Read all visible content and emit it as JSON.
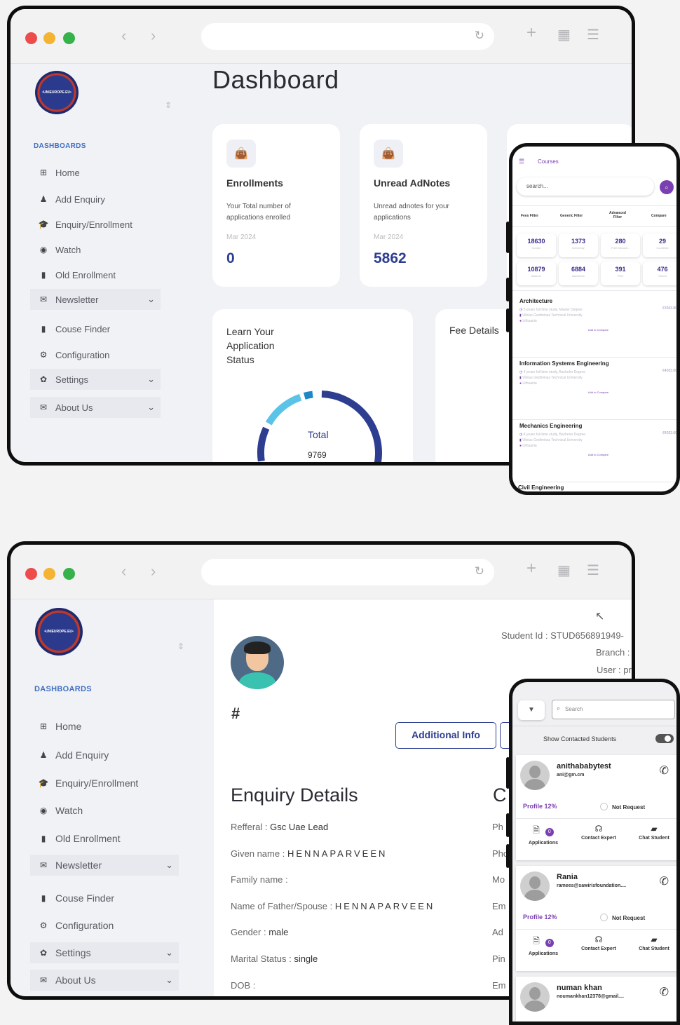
{
  "top": {
    "sidebar": {
      "section": "DASHBOARDS",
      "items": [
        {
          "label": "Home",
          "icon": "dashboard-icon"
        },
        {
          "label": "Add Enquiry",
          "icon": "user-icon"
        },
        {
          "label": "Enquiry/Enrollment",
          "icon": "graduation-cap-icon"
        },
        {
          "label": "Watch",
          "icon": "eye-icon"
        },
        {
          "label": "Old Enrollment",
          "icon": "book-icon"
        },
        {
          "label": "Newsletter",
          "icon": "envelope-icon",
          "expandable": true
        },
        {
          "label": "Couse Finder",
          "icon": "book-icon"
        },
        {
          "label": "Configuration",
          "icon": "cogs-icon"
        },
        {
          "label": "Settings",
          "icon": "gear-icon",
          "expandable": true
        },
        {
          "label": "About Us",
          "icon": "envelope-icon",
          "expandable": true
        }
      ]
    },
    "page_title": "Dashboard",
    "cards": [
      {
        "title": "Enrollments",
        "desc": "Your Total number of applications enrolled",
        "date": "Mar 2024",
        "value": "0"
      },
      {
        "title": "Unread AdNotes",
        "desc": "Unread adnotes for your applications",
        "date": "Mar 2024",
        "value": "5862"
      }
    ],
    "status_card": {
      "title": "Learn Your Application Status",
      "center_label": "Total",
      "center_value": "9769"
    },
    "fee_card": {
      "title": "Fee Details"
    }
  },
  "courses_phone": {
    "header": "Courses",
    "search_placeholder": "search...",
    "filters": [
      "Fees Filter",
      "Generic Filter",
      "Advanced Filter",
      "Compare"
    ],
    "stats_row1": [
      {
        "v": "18630",
        "l": "Course"
      },
      {
        "v": "1373",
        "l": "University"
      },
      {
        "v": "280",
        "l": "Free Educati..."
      },
      {
        "v": "29",
        "l": "Countries"
      }
    ],
    "stats_row2": [
      {
        "v": "10879",
        "l": "Masters"
      },
      {
        "v": "6884",
        "l": "Bachelors"
      },
      {
        "v": "391",
        "l": "PHD"
      },
      {
        "v": "476",
        "l": "Others"
      }
    ],
    "courses": [
      {
        "name": "Architecture",
        "duration": "5 years full time study, Master Degree",
        "university": "Vilnius Gediminas Technical University",
        "country": "Lithuania",
        "fee": "€3363.80",
        "add": "Add to Compare"
      },
      {
        "name": "Information Systems Engineering",
        "duration": "4 years full time study, Bachelor Degree",
        "university": "Vilnius Gediminas Technical University",
        "country": "Lithuania",
        "fee": "€4023.00",
        "add": "Add to Compare"
      },
      {
        "name": "Mechanics Engineering",
        "duration": "4 years full time study, Bachelor Degree",
        "university": "Vilnius Gediminas Technical University",
        "country": "Lithuania",
        "fee": "€4023.00",
        "add": "Add to Compare"
      }
    ],
    "next_course": "Civil Engineering"
  },
  "bottom": {
    "sidebar": {
      "section": "DASHBOARDS",
      "items": [
        {
          "label": "Home"
        },
        {
          "label": "Add Enquiry"
        },
        {
          "label": "Enquiry/Enrollment"
        },
        {
          "label": "Watch"
        },
        {
          "label": "Old Enrollment"
        },
        {
          "label": "Newsletter"
        },
        {
          "label": "Couse Finder"
        },
        {
          "label": "Configuration"
        },
        {
          "label": "Settings"
        },
        {
          "label": "About Us"
        }
      ]
    },
    "student_id": "Student Id : STUD656891949-",
    "branch": "Branch :",
    "user": "User : pr",
    "hash": "#",
    "additional_info_btn": "Additional Info",
    "section_title": "Enquiry Details",
    "second_title": "C",
    "fields": [
      {
        "label": "Refferal : ",
        "value": "Gsc Uae Lead"
      },
      {
        "label": "Given name : ",
        "value": "HENNAPARVEEN"
      },
      {
        "label": "Family name : ",
        "value": ""
      },
      {
        "label": "Name of Father/Spouse : ",
        "value": "HENNAPARVEEN"
      },
      {
        "label": "Gender : ",
        "value": "male"
      },
      {
        "label": "Marital Status : ",
        "value": "single"
      },
      {
        "label": "DOB : ",
        "value": ""
      }
    ],
    "right_labels": [
      "Ph",
      "Pho",
      "Mo",
      "Em",
      "Ad",
      "Pin",
      "Em"
    ]
  },
  "students_phone": {
    "search_placeholder": "Search",
    "toggle_label": "Show Contacted Students",
    "students": [
      {
        "name": "anithababytest",
        "email": "ani@gm.cm",
        "profile": "Profile 12%",
        "request": "Not Request",
        "badge": "0"
      },
      {
        "name": "Rania",
        "email": "ramees@sawirisfoundation....",
        "profile": "Profile 12%",
        "request": "Not Request",
        "badge": "0"
      },
      {
        "name": "numan khan",
        "email": "noumankhan12378@gmail....",
        "profile": "",
        "request": "",
        "badge": ""
      }
    ],
    "actions": [
      "Applications",
      "Contact Expert",
      "Chat Student"
    ]
  },
  "colors": {
    "accent": "#2d3e91",
    "purple": "#7a3fb0",
    "sidebar_bg": "#f1f2f5"
  }
}
